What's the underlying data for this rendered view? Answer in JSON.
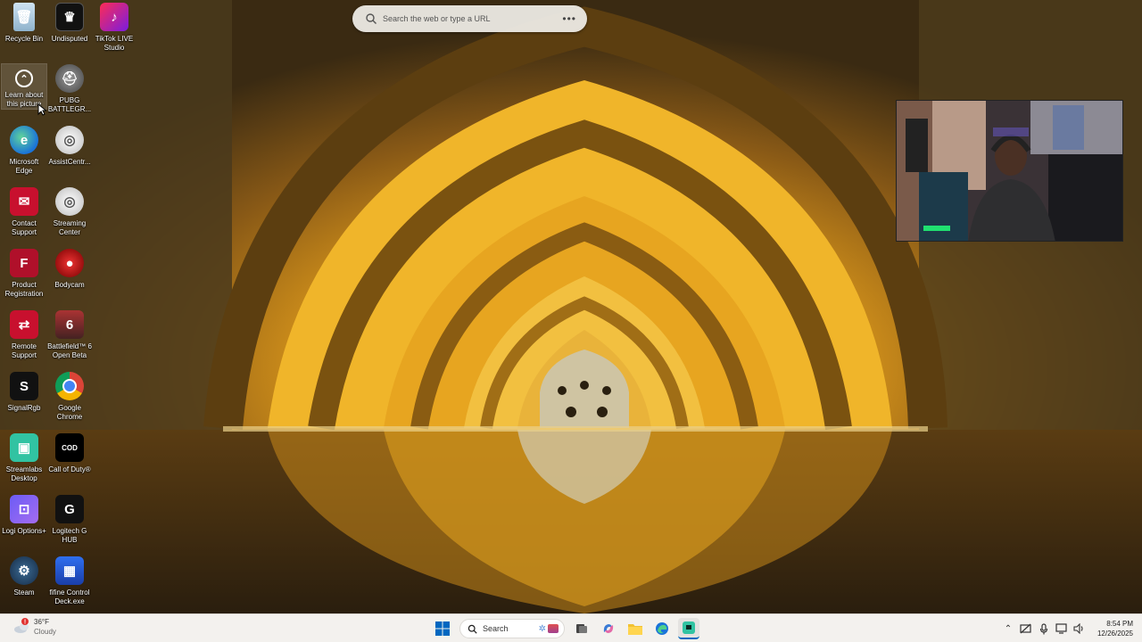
{
  "desktop": {
    "icons": [
      {
        "label": "Recycle Bin",
        "icon": "recycle-bin-icon"
      },
      {
        "label": "Undisputed",
        "icon": "undisputed-icon"
      },
      {
        "label": "TikTok LIVE Studio",
        "icon": "tiktok-icon"
      },
      {
        "label": "Learn about this picture",
        "icon": "learn-picture-icon"
      },
      {
        "label": "PUBG BATTLEGR...",
        "icon": "pubg-icon"
      },
      {
        "label": "Microsoft Edge",
        "icon": "edge-icon"
      },
      {
        "label": "AssistCentr...",
        "icon": "assistcentral-icon"
      },
      {
        "label": "Contact Support",
        "icon": "contact-support-icon"
      },
      {
        "label": "Streaming Center",
        "icon": "streaming-center-icon"
      },
      {
        "label": "Product Registration",
        "icon": "product-registration-icon"
      },
      {
        "label": "Bodycam",
        "icon": "bodycam-icon"
      },
      {
        "label": "Remote Support",
        "icon": "remote-support-icon"
      },
      {
        "label": "Battlefield™ 6 Open Beta",
        "icon": "battlefield-icon"
      },
      {
        "label": "SignalRgb",
        "icon": "signalrgb-icon"
      },
      {
        "label": "Google Chrome",
        "icon": "chrome-icon"
      },
      {
        "label": "Streamlabs Desktop",
        "icon": "streamlabs-icon"
      },
      {
        "label": "Call of Duty®",
        "icon": "call-of-duty-icon"
      },
      {
        "label": "Logi Options+",
        "icon": "logi-options-icon"
      },
      {
        "label": "Logitech G HUB",
        "icon": "logitech-ghub-icon"
      },
      {
        "label": "Steam",
        "icon": "steam-icon"
      },
      {
        "label": "fifine Control Deck.exe",
        "icon": "fifine-icon"
      }
    ]
  },
  "edge_search": {
    "placeholder": "Search the web or type a URL",
    "more_icon": "more-dots-icon"
  },
  "taskbar": {
    "weather": {
      "temp": "36°F",
      "condition": "Cloudy",
      "alert": "!"
    },
    "search_label": "Search",
    "clock": {
      "time": "8:54 PM",
      "date": "12/26/2025"
    },
    "pinned": [
      "windows-start-icon",
      "search-icon",
      "task-view-icon",
      "copilot-icon",
      "file-explorer-icon",
      "edge-icon",
      "streamlabs-icon"
    ]
  },
  "colors": {
    "taskbar_bg": "#f3f1ee",
    "accent_blue": "#0067c0",
    "wallpaper_gold": "#e0a21a"
  }
}
